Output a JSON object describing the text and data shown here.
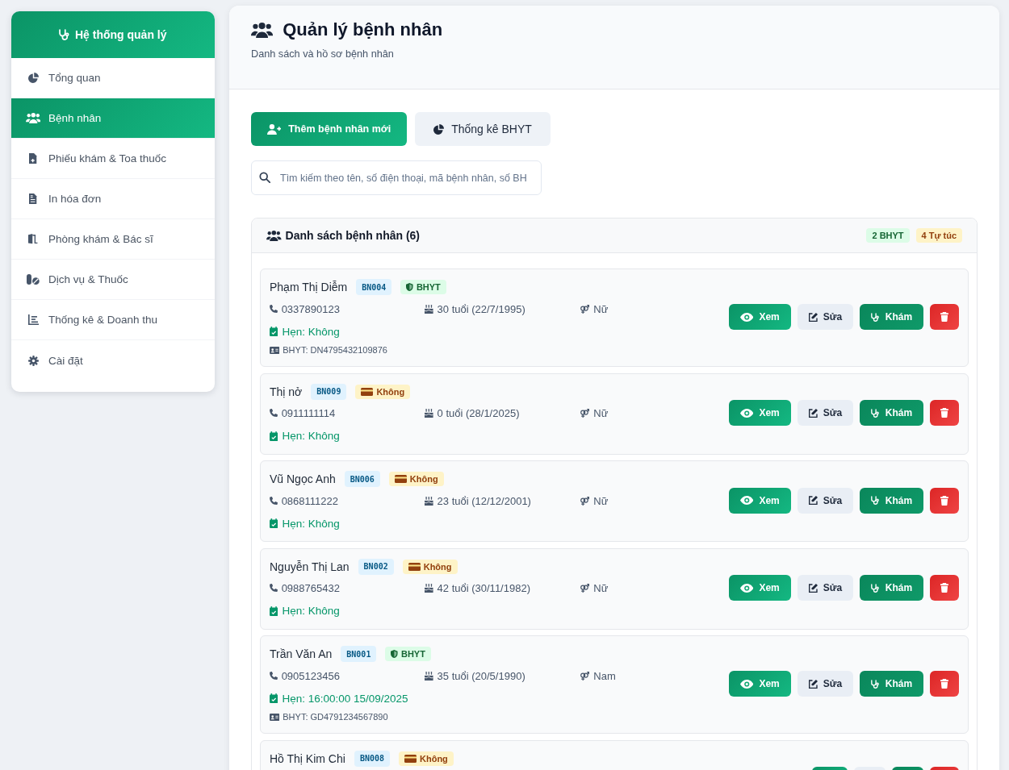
{
  "sidebar": {
    "title": "Hệ thống quản lý",
    "items": [
      {
        "label": "Tổng quan",
        "selected": false
      },
      {
        "label": "Bệnh nhân",
        "selected": true
      },
      {
        "label": "Phiếu khám & Toa thuốc",
        "selected": false
      },
      {
        "label": "In hóa đơn",
        "selected": false
      },
      {
        "label": "Phòng khám & Bác sĩ",
        "selected": false
      },
      {
        "label": "Dịch vụ & Thuốc",
        "selected": false
      },
      {
        "label": "Thống kê & Doanh thu",
        "selected": false
      },
      {
        "label": "Cài đặt",
        "selected": false
      }
    ]
  },
  "header": {
    "title": "Quản lý bệnh nhân",
    "subtitle": "Danh sách và hồ sơ bệnh nhân"
  },
  "toolbar": [
    {
      "kind": "primary",
      "label": "Thêm bệnh nhân mới"
    },
    {
      "kind": "secondary",
      "label": "Thống kê BHYT"
    }
  ],
  "search": {
    "placeholder": "Tìm kiếm theo tên, số điện thoại, mã bệnh nhân, số BH"
  },
  "patient_list": {
    "title": "Danh sách bệnh nhân (6)",
    "counts": [
      {
        "kind": "insured",
        "label": "2 BHYT"
      },
      {
        "kind": "self_pay",
        "label": "4 Tự túc"
      }
    ],
    "patients": [
      {
        "name": "Phạm Thị Diễm",
        "code": "BN004",
        "insurance": {
          "kind": "insured",
          "label": "BHYT"
        },
        "phone": "0337890123",
        "age": "30 tuổi (22/7/1995)",
        "gender": "Nữ",
        "appointment": "Hẹn: Không",
        "insurance_number": "BHYT: DN4795432109876",
        "actions": [
          {
            "kind": "view",
            "label": "Xem"
          },
          {
            "kind": "edit",
            "label": "Sửa"
          },
          {
            "kind": "exam",
            "label": "Khám"
          },
          {
            "kind": "delete"
          }
        ]
      },
      {
        "name": "Thị nở",
        "code": "BN009",
        "insurance": {
          "kind": "none",
          "label": "Không"
        },
        "phone": "0911111114",
        "age": "0 tuổi (28/1/2025)",
        "gender": "Nữ",
        "appointment": "Hẹn: Không",
        "actions": [
          {
            "kind": "view",
            "label": "Xem"
          },
          {
            "kind": "edit",
            "label": "Sửa"
          },
          {
            "kind": "exam",
            "label": "Khám"
          },
          {
            "kind": "delete"
          }
        ]
      },
      {
        "name": "Vũ Ngọc Anh",
        "code": "BN006",
        "insurance": {
          "kind": "none",
          "label": "Không"
        },
        "phone": "0868111222",
        "age": "23 tuổi (12/12/2001)",
        "gender": "Nữ",
        "appointment": "Hẹn: Không",
        "actions": [
          {
            "kind": "view",
            "label": "Xem"
          },
          {
            "kind": "edit",
            "label": "Sửa"
          },
          {
            "kind": "exam",
            "label": "Khám"
          },
          {
            "kind": "delete"
          }
        ]
      },
      {
        "name": "Nguyễn Thị Lan",
        "code": "BN002",
        "insurance": {
          "kind": "none",
          "label": "Không"
        },
        "phone": "0988765432",
        "age": "42 tuổi (30/11/1982)",
        "gender": "Nữ",
        "appointment": "Hẹn: Không",
        "actions": [
          {
            "kind": "view",
            "label": "Xem"
          },
          {
            "kind": "edit",
            "label": "Sửa"
          },
          {
            "kind": "exam",
            "label": "Khám"
          },
          {
            "kind": "delete"
          }
        ]
      },
      {
        "name": "Trần Văn An",
        "code": "BN001",
        "insurance": {
          "kind": "insured",
          "label": "BHYT"
        },
        "phone": "0905123456",
        "age": "35 tuổi (20/5/1990)",
        "gender": "Nam",
        "appointment": "Hẹn: 16:00:00 15/09/2025",
        "insurance_number": "BHYT: GD4791234567890",
        "actions": [
          {
            "kind": "view",
            "label": "Xem"
          },
          {
            "kind": "edit",
            "label": "Sửa"
          },
          {
            "kind": "exam",
            "label": "Khám"
          },
          {
            "kind": "delete"
          }
        ]
      },
      {
        "name": "Hồ Thị Kim Chi",
        "code": "BN008",
        "insurance": {
          "kind": "none",
          "label": "Không"
        },
        "actions": [
          {
            "kind": "view"
          },
          {
            "kind": "edit"
          },
          {
            "kind": "exam"
          },
          {
            "kind": "delete"
          }
        ]
      }
    ]
  }
}
